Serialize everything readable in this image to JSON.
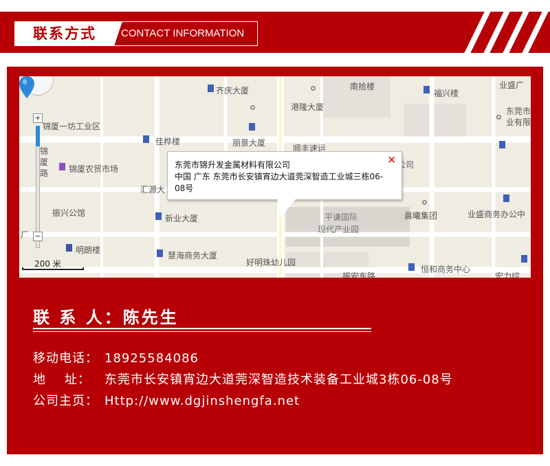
{
  "header": {
    "title_cn": "联系方式",
    "title_en": "CONTACT INFORMATION"
  },
  "colors": {
    "brand_red": "#b60005",
    "map_bg": "#efece2",
    "pin_blue": "#2d88d9"
  },
  "map": {
    "scale_label": "200 米",
    "popup": {
      "company_name": "东莞市锦升发金属材料有限公司",
      "address": "中国 广东 东莞市长安镇宵边大道莞深智造工业城三栋06-08号",
      "close_icon": "×"
    },
    "labels": [
      {
        "text": "齐庆大厦"
      },
      {
        "text": "南拾楼"
      },
      {
        "text": "福兴楼"
      },
      {
        "text": "业盛广"
      },
      {
        "text": "港隆大厦"
      },
      {
        "text": "东莞市"
      },
      {
        "text": "业有限"
      },
      {
        "text": "锦厦一坊工业区"
      },
      {
        "text": "佳桦楼"
      },
      {
        "text": "丽景大厦"
      },
      {
        "text": "顺丰速运"
      },
      {
        "text": "锦厦农贸市场"
      },
      {
        "text": "汇源大"
      },
      {
        "text": "公司"
      },
      {
        "text": "振兴公馆"
      },
      {
        "text": "新业大厦"
      },
      {
        "text": "平谦国际"
      },
      {
        "text": "现代产业园"
      },
      {
        "text": "晨曦集团"
      },
      {
        "text": "业盛商务办公中"
      },
      {
        "text": "明朗楼"
      },
      {
        "text": "慧海商务大厦"
      },
      {
        "text": "好明珠幼儿园"
      },
      {
        "text": "恒和商务中心"
      },
      {
        "text": "锦"
      },
      {
        "text": "厦"
      },
      {
        "text": "路"
      },
      {
        "text": "厂"
      },
      {
        "text": "振安东路"
      },
      {
        "text": "宏力综"
      }
    ]
  },
  "contact": {
    "person": "联 系  人：陈先生",
    "rows": [
      {
        "label": "移动电话：",
        "value": "18925584086"
      },
      {
        "label": "地    址：",
        "value": "东莞市长安镇宵边大道莞深智造技术装备工业城3栋06-08号"
      },
      {
        "label": "公司主页：",
        "value": "Http://www.dgjinshengfa.net"
      }
    ]
  }
}
